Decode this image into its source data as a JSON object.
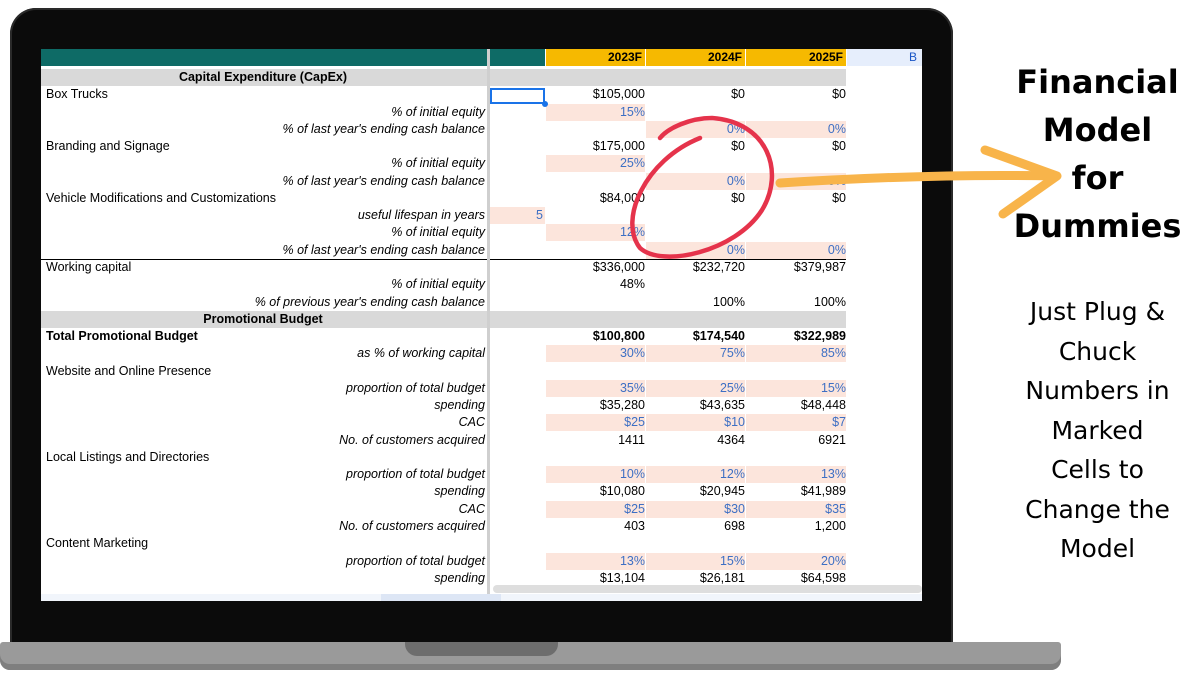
{
  "sheet": {
    "years": [
      "2023F",
      "2024F",
      "2025F"
    ],
    "extra_header": "B",
    "rows": [
      {
        "kind": "section",
        "label": "Capital Expenditure (CapEx)"
      },
      {
        "kind": "item",
        "label": "Box Trucks",
        "g": "",
        "y1": "$105,000",
        "y2": "$0",
        "y3": "$0",
        "inp": []
      },
      {
        "kind": "sub",
        "label": "% of initial equity",
        "g": "",
        "y1": "15%",
        "y2": "",
        "y3": "",
        "inp": [
          "y1"
        ]
      },
      {
        "kind": "sub",
        "label": "% of last year's ending cash balance",
        "g": "",
        "y1": "",
        "y2": "0%",
        "y3": "0%",
        "inp": [
          "y2",
          "y3"
        ]
      },
      {
        "kind": "item",
        "label": "Branding and Signage",
        "g": "",
        "y1": "$175,000",
        "y2": "$0",
        "y3": "$0",
        "inp": []
      },
      {
        "kind": "sub",
        "label": "% of initial equity",
        "g": "",
        "y1": "25%",
        "y2": "",
        "y3": "",
        "inp": [
          "y1"
        ]
      },
      {
        "kind": "sub",
        "label": "% of last year's ending cash balance",
        "g": "",
        "y1": "",
        "y2": "0%",
        "y3": "0%",
        "inp": [
          "y2",
          "y3"
        ]
      },
      {
        "kind": "item",
        "label": "Vehicle Modifications and Customizations",
        "g": "",
        "y1": "$84,000",
        "y2": "$0",
        "y3": "$0",
        "inp": []
      },
      {
        "kind": "sub",
        "label": "useful lifespan in years",
        "g": "5",
        "y1": "",
        "y2": "",
        "y3": "",
        "inp": [
          "g"
        ]
      },
      {
        "kind": "sub",
        "label": "% of initial equity",
        "g": "",
        "y1": "12%",
        "y2": "",
        "y3": "",
        "inp": [
          "y1"
        ]
      },
      {
        "kind": "sub",
        "label": "% of last year's ending cash balance",
        "g": "",
        "y1": "",
        "y2": "0%",
        "y3": "0%",
        "inp": [
          "y2",
          "y3"
        ]
      },
      {
        "kind": "item",
        "label": "Working capital",
        "g": "",
        "y1": "$336,000",
        "y2": "$232,720",
        "y3": "$379,987",
        "inp": []
      },
      {
        "kind": "sub",
        "label": "% of initial equity",
        "g": "",
        "y1": "48%",
        "y2": "",
        "y3": "",
        "inp": []
      },
      {
        "kind": "sub",
        "label": "% of previous year's ending cash balance",
        "g": "",
        "y1": "",
        "y2": "100%",
        "y3": "100%",
        "inp": []
      },
      {
        "kind": "section",
        "label": "Promotional Budget"
      },
      {
        "kind": "total",
        "label": "Total Promotional Budget",
        "g": "",
        "y1": "$100,800",
        "y2": "$174,540",
        "y3": "$322,989",
        "inp": []
      },
      {
        "kind": "sub",
        "label": "as % of working capital",
        "g": "",
        "y1": "30%",
        "y2": "75%",
        "y3": "85%",
        "inp": [
          "y1",
          "y2",
          "y3"
        ]
      },
      {
        "kind": "item",
        "label": "Website and Online Presence",
        "g": "",
        "y1": "",
        "y2": "",
        "y3": "",
        "inp": []
      },
      {
        "kind": "sub",
        "label": "proportion of total budget",
        "g": "",
        "y1": "35%",
        "y2": "25%",
        "y3": "15%",
        "inp": [
          "y1",
          "y2",
          "y3"
        ]
      },
      {
        "kind": "sub",
        "label": "spending",
        "g": "",
        "y1": "$35,280",
        "y2": "$43,635",
        "y3": "$48,448",
        "inp": []
      },
      {
        "kind": "sub",
        "label": "CAC",
        "g": "",
        "y1": "$25",
        "y2": "$10",
        "y3": "$7",
        "inp": [
          "y1",
          "y2",
          "y3"
        ]
      },
      {
        "kind": "sub",
        "label": "No. of customers acquired",
        "g": "",
        "y1": "1411",
        "y2": "4364",
        "y3": "6921",
        "inp": []
      },
      {
        "kind": "item",
        "label": "Local Listings and Directories",
        "g": "",
        "y1": "",
        "y2": "",
        "y3": "",
        "inp": []
      },
      {
        "kind": "sub",
        "label": "proportion of total budget",
        "g": "",
        "y1": "10%",
        "y2": "12%",
        "y3": "13%",
        "inp": [
          "y1",
          "y2",
          "y3"
        ]
      },
      {
        "kind": "sub",
        "label": "spending",
        "g": "",
        "y1": "$10,080",
        "y2": "$20,945",
        "y3": "$41,989",
        "inp": []
      },
      {
        "kind": "sub",
        "label": "CAC",
        "g": "",
        "y1": "$25",
        "y2": "$30",
        "y3": "$35",
        "inp": [
          "y1",
          "y2",
          "y3"
        ]
      },
      {
        "kind": "sub",
        "label": "No. of customers acquired",
        "g": "",
        "y1": "403",
        "y2": "698",
        "y3": "1,200",
        "inp": []
      },
      {
        "kind": "item",
        "label": "Content Marketing",
        "g": "",
        "y1": "",
        "y2": "",
        "y3": "",
        "inp": []
      },
      {
        "kind": "sub",
        "label": "proportion of total budget",
        "g": "",
        "y1": "13%",
        "y2": "15%",
        "y3": "20%",
        "inp": [
          "y1",
          "y2",
          "y3"
        ]
      },
      {
        "kind": "sub",
        "label": "spending",
        "g": "",
        "y1": "$13,104",
        "y2": "$26,181",
        "y3": "$64,598",
        "inp": []
      }
    ]
  },
  "caption": {
    "title_lines": [
      "Financial",
      "Model",
      "for",
      "Dummies"
    ],
    "tagline_lines": [
      "Just Plug &",
      "Chuck",
      "Numbers in",
      "Marked",
      "Cells to",
      "Change the",
      "Model"
    ]
  },
  "colors": {
    "header_teal": "#0e6b66",
    "header_year": "#f6b900",
    "input_fill": "#fce5dc",
    "input_text": "#3d6fc4",
    "circle_red": "#e5334b",
    "arrow_orange": "#f8b44a"
  },
  "icons": {
    "annotation_circle": "red-circle-annotation",
    "annotation_arrow": "orange-arrow"
  }
}
